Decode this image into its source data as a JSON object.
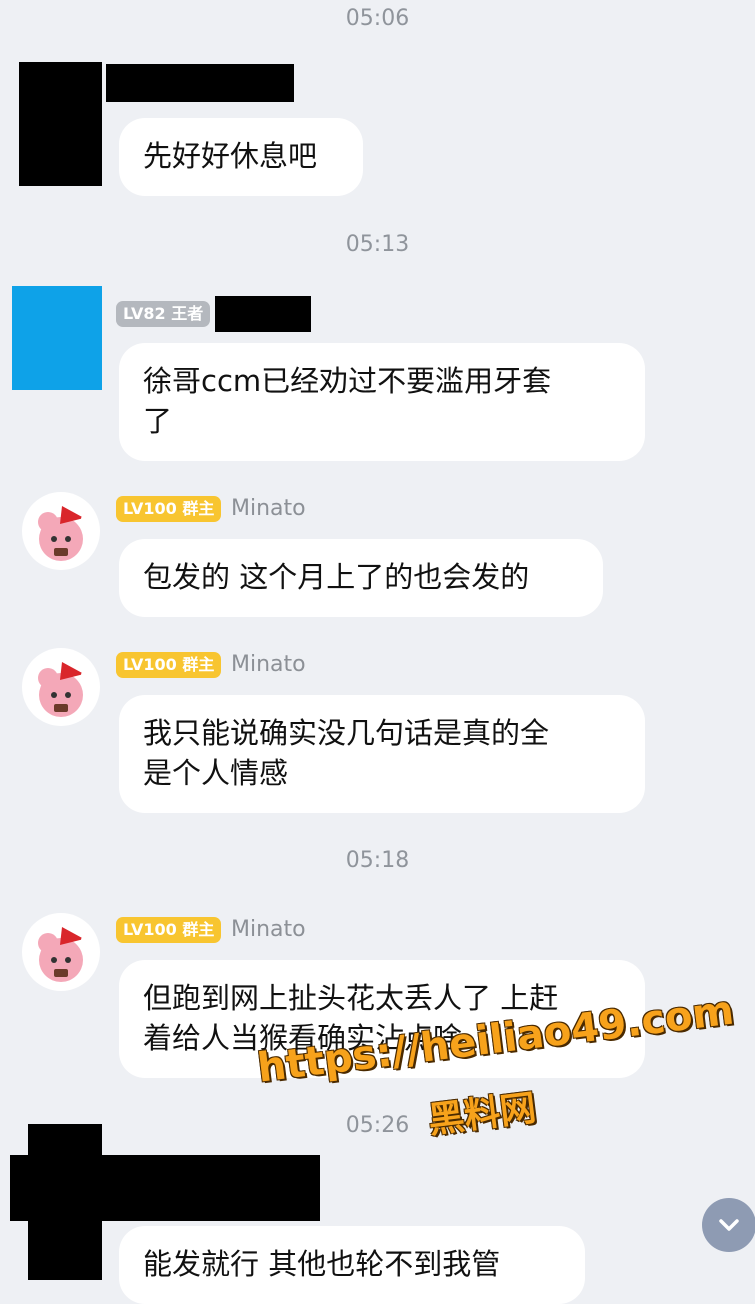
{
  "timestamps": [
    "05:06",
    "05:13",
    "05:18",
    "05:26"
  ],
  "messages": [
    {
      "text": "先好好休息吧"
    },
    {
      "badge": "LV82 王者",
      "text_line1": "徐哥ccm已经劝过不要滥用牙套",
      "text_line2": "了"
    },
    {
      "badge": "LV100 群主",
      "name": "Minato",
      "text": "包发的 这个月上了的也会发的"
    },
    {
      "badge": "LV100 群主",
      "name": "Minato",
      "text_line1": "我只能说确实没几句话是真的全",
      "text_line2": "是个人情感"
    },
    {
      "badge": "LV100 群主",
      "name": "Minato",
      "text_line1": "但跑到网上扯头花太丢人了 上赶",
      "text_line2": "着给人当猴看确实沾点啥"
    },
    {
      "text": "能发就行 其他也轮不到我管"
    }
  ],
  "watermark": {
    "line1": "https://heiliao49.com",
    "line2": "黑料网"
  },
  "icons": {
    "scroll_down": "chevron-down-icon"
  },
  "colors": {
    "background": "#eef0f4",
    "bubble": "#ffffff",
    "badge_owner": "#f8c530",
    "badge_level": "#b4b8be",
    "avatar_blue": "#0ea2e8"
  }
}
